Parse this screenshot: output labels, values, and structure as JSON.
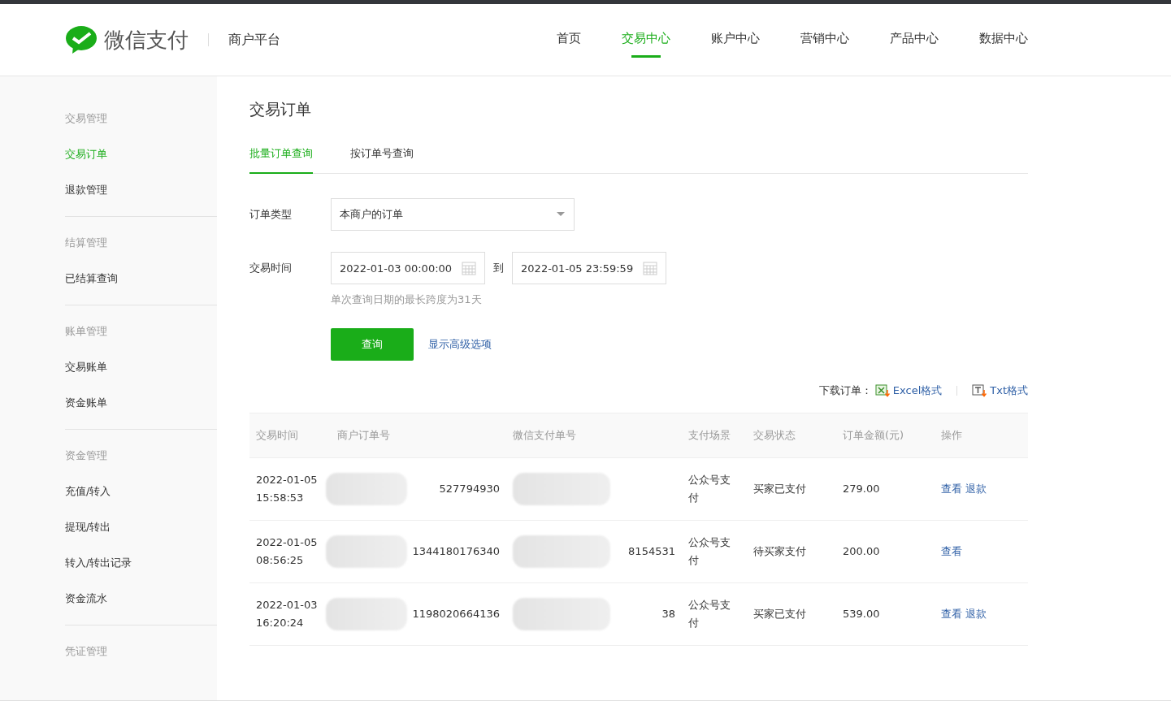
{
  "header": {
    "brand": "微信支付",
    "platform": "商户平台",
    "nav": [
      {
        "label": "首页",
        "selected": false
      },
      {
        "label": "交易中心",
        "selected": true
      },
      {
        "label": "账户中心",
        "selected": false
      },
      {
        "label": "营销中心",
        "selected": false
      },
      {
        "label": "产品中心",
        "selected": false
      },
      {
        "label": "数据中心",
        "selected": false
      }
    ]
  },
  "sidebar": {
    "groups": [
      {
        "title": "交易管理",
        "items": [
          {
            "label": "交易订单",
            "selected": true
          },
          {
            "label": "退款管理",
            "selected": false
          }
        ]
      },
      {
        "title": "结算管理",
        "items": [
          {
            "label": "已结算查询",
            "selected": false
          }
        ]
      },
      {
        "title": "账单管理",
        "items": [
          {
            "label": "交易账单",
            "selected": false
          },
          {
            "label": "资金账单",
            "selected": false
          }
        ]
      },
      {
        "title": "资金管理",
        "items": [
          {
            "label": "充值/转入",
            "selected": false
          },
          {
            "label": "提现/转出",
            "selected": false
          },
          {
            "label": "转入/转出记录",
            "selected": false
          },
          {
            "label": "资金流水",
            "selected": false
          }
        ]
      },
      {
        "title": "凭证管理"
      }
    ]
  },
  "page": {
    "title": "交易订单",
    "tabs": [
      {
        "label": "批量订单查询",
        "selected": true
      },
      {
        "label": "按订单号查询",
        "selected": false
      }
    ],
    "form": {
      "order_type_label": "订单类型",
      "order_type_value": "本商户的订单",
      "time_label": "交易时间",
      "start": "2022-01-03 00:00:00",
      "to": "到",
      "end": "2022-01-05 23:59:59",
      "hint": "单次查询日期的最长跨度为31天",
      "query_button": "查询",
      "advanced_link": "显示高级选项"
    },
    "download": {
      "label": "下载订单：",
      "excel": "Excel格式",
      "txt": "Txt格式"
    },
    "table": {
      "columns": [
        "交易时间",
        "商户订单号",
        "微信支付单号",
        "支付场景",
        "交易状态",
        "订单金额(元)",
        "操作"
      ],
      "rows": [
        {
          "time": "2022-01-05 15:58:53",
          "order_no": "527794930",
          "scene": "公众号支付",
          "status": "买家已支付",
          "amount": "279.00",
          "actions": [
            "查看",
            "退款"
          ]
        },
        {
          "time": "2022-01-05 08:56:25",
          "order_no": "1344180176340",
          "wx_no": "8154531",
          "scene": "公众号支付",
          "status": "待买家支付",
          "amount": "200.00",
          "actions": [
            "查看"
          ]
        },
        {
          "time": "2022-01-03 16:20:24",
          "order_no": "1198020664136",
          "wx_no": "38",
          "scene": "公众号支付",
          "status": "买家已支付",
          "amount": "539.00",
          "actions": [
            "查看",
            "退款"
          ]
        }
      ]
    }
  }
}
